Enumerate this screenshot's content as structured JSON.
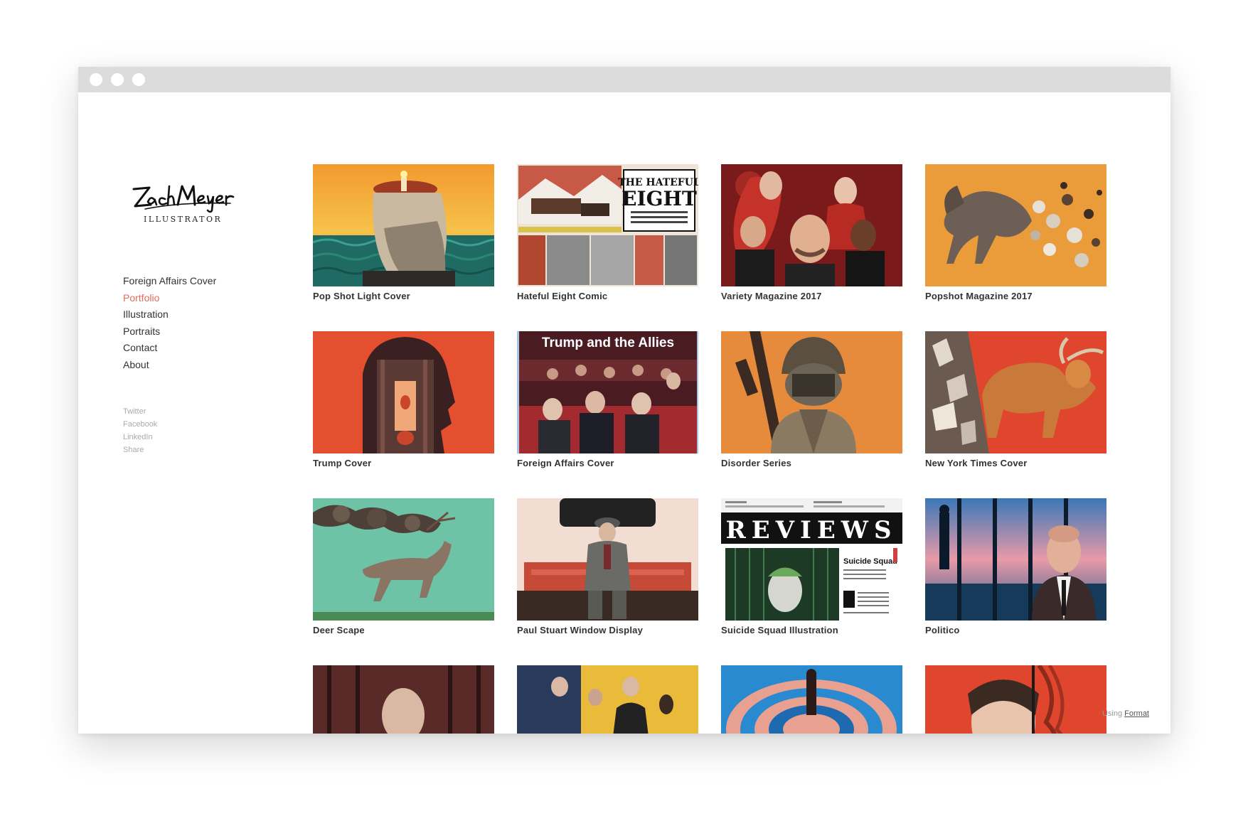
{
  "window": {
    "dots": [
      "close",
      "minimize",
      "maximize"
    ]
  },
  "logo": {
    "name": "ZachMeyer",
    "subtitle": "ILLUSTRATOR"
  },
  "nav": [
    {
      "label": "Foreign Affairs Cover",
      "active": false
    },
    {
      "label": "Portfolio",
      "active": true
    },
    {
      "label": "Illustration",
      "active": false
    },
    {
      "label": "Portraits",
      "active": false
    },
    {
      "label": "Contact",
      "active": false
    },
    {
      "label": "About",
      "active": false
    }
  ],
  "social": [
    "Twitter",
    "Facebook",
    "LinkedIn",
    "Share"
  ],
  "portfolio": [
    {
      "title": "Pop Shot Light Cover"
    },
    {
      "title": "Hateful Eight Comic"
    },
    {
      "title": "Variety Magazine 2017"
    },
    {
      "title": "Popshot Magazine 2017"
    },
    {
      "title": "Trump Cover"
    },
    {
      "title": "Foreign Affairs Cover"
    },
    {
      "title": "Disorder Series"
    },
    {
      "title": "New York Times Cover"
    },
    {
      "title": "Deer Scape"
    },
    {
      "title": "Paul Stuart Window Display"
    },
    {
      "title": "Suicide Squad Illustration"
    },
    {
      "title": "Politico"
    },
    {
      "title": ""
    },
    {
      "title": ""
    },
    {
      "title": ""
    },
    {
      "title": ""
    }
  ],
  "thumb_text": {
    "hateful_title_1": "THE HATEFUL",
    "hateful_title_2": "EIGHT",
    "foreign_affairs_headline": "Trump and the Allies",
    "reviews_headline": "REVIEWS",
    "reviews_subhead": "Suicide Squad"
  },
  "footer": {
    "prefix": "Using",
    "link": "Format"
  },
  "colors": {
    "accent": "#e36c5a",
    "titlebar": "#dcdcdc",
    "caption": "#333333"
  }
}
